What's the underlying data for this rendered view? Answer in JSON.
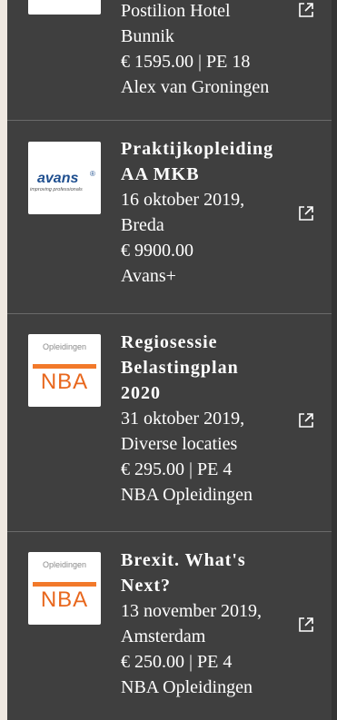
{
  "items": [
    {
      "logo": "",
      "title": "",
      "lines": [
        "Postilion Hotel",
        "Bunnik",
        "€ 1595.00 | PE 18",
        "Alex van Groningen"
      ],
      "icon": "external-link-icon"
    },
    {
      "logo": {
        "word": "avans",
        "tagline": "improving professionals",
        "mark": "®"
      },
      "title": [
        "Praktijkopleiding",
        "AA MKB"
      ],
      "lines": [
        "16 oktober 2019,",
        "Breda",
        "€ 9900.00",
        "Avans+"
      ],
      "icon": "external-link-icon"
    },
    {
      "logo": {
        "top": "Opleidingen",
        "word": "NBA"
      },
      "title": [
        "Regiosessie",
        "Belastingplan",
        "2020"
      ],
      "lines": [
        "31 oktober 2019,",
        "Diverse locaties",
        "€ 295.00 | PE 4",
        "NBA Opleidingen"
      ],
      "icon": "external-link-icon"
    },
    {
      "logo": {
        "top": "Opleidingen",
        "word": "NBA"
      },
      "title": [
        "Brexit. What's",
        "Next?"
      ],
      "lines": [
        "13 november 2019,",
        "Amsterdam",
        "€ 250.00 | PE 4",
        "NBA Opleidingen"
      ],
      "icon": "external-link-icon"
    }
  ],
  "colors": {
    "panel": "#3f3f3f",
    "page_bg": "#efe8e1",
    "text": "#ffffff",
    "nba_orange": "#f2792a",
    "avans_blue": "#1f4f8f"
  }
}
